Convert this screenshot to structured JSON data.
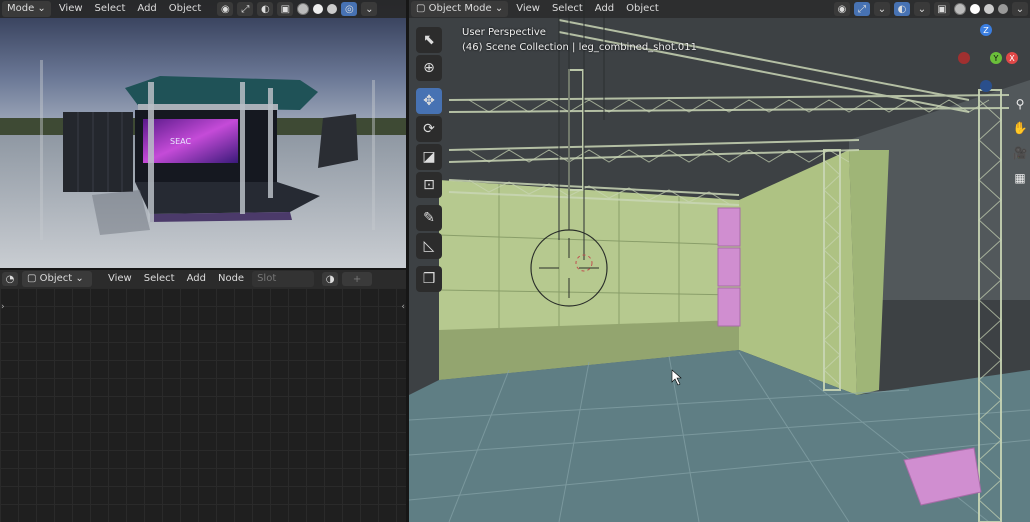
{
  "render_view": {
    "mode_label": "Mode",
    "menus": [
      "View",
      "Select",
      "Add",
      "Object"
    ],
    "screen_text": "SEAC"
  },
  "node_editor": {
    "object_label": "Object",
    "menus": [
      "View",
      "Select",
      "Add",
      "Node"
    ],
    "slot_label": "Slot"
  },
  "viewport": {
    "mode_label": "Object Mode",
    "menus": [
      "View",
      "Select",
      "Add",
      "Object"
    ],
    "perspective_label": "User Perspective",
    "collection_label": "(46) Scene Collection | leg_combined_shot.011",
    "gizmo": {
      "z": "Z",
      "x": "X",
      "y": "Y"
    },
    "colors": {
      "floor": "#5f7e84",
      "wall": "#b6c98f",
      "pink": "#d08ed0",
      "active": "#4772b3"
    }
  }
}
